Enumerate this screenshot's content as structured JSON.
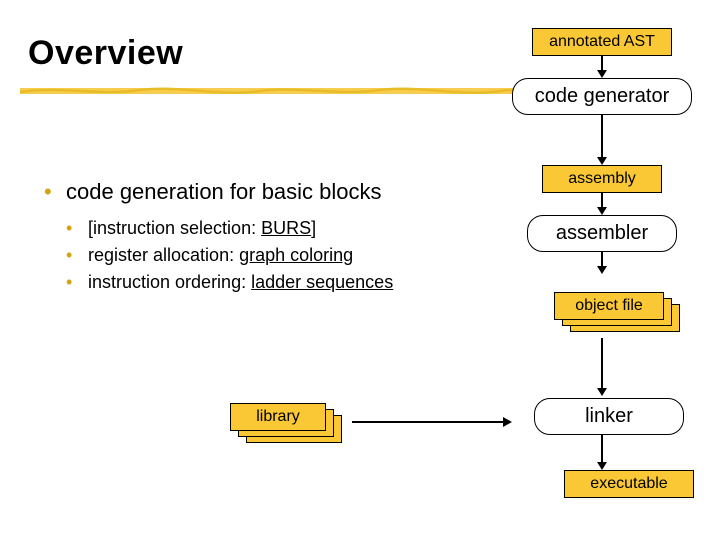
{
  "title": "Overview",
  "bullets": {
    "main": "code generation for basic blocks",
    "sub1_a": "[instruction selection: ",
    "sub1_b": "BURS",
    "sub1_c": "]",
    "sub2_a": "register allocation: ",
    "sub2_b": "graph coloring",
    "sub3_a": "instruction ordering: ",
    "sub3_b": "ladder sequences"
  },
  "flow": {
    "annotated_ast": "annotated AST",
    "code_generator": "code generator",
    "assembly": "assembly",
    "assembler": "assembler",
    "object_file": "object file",
    "linker": "linker",
    "executable": "executable",
    "library": "library"
  }
}
